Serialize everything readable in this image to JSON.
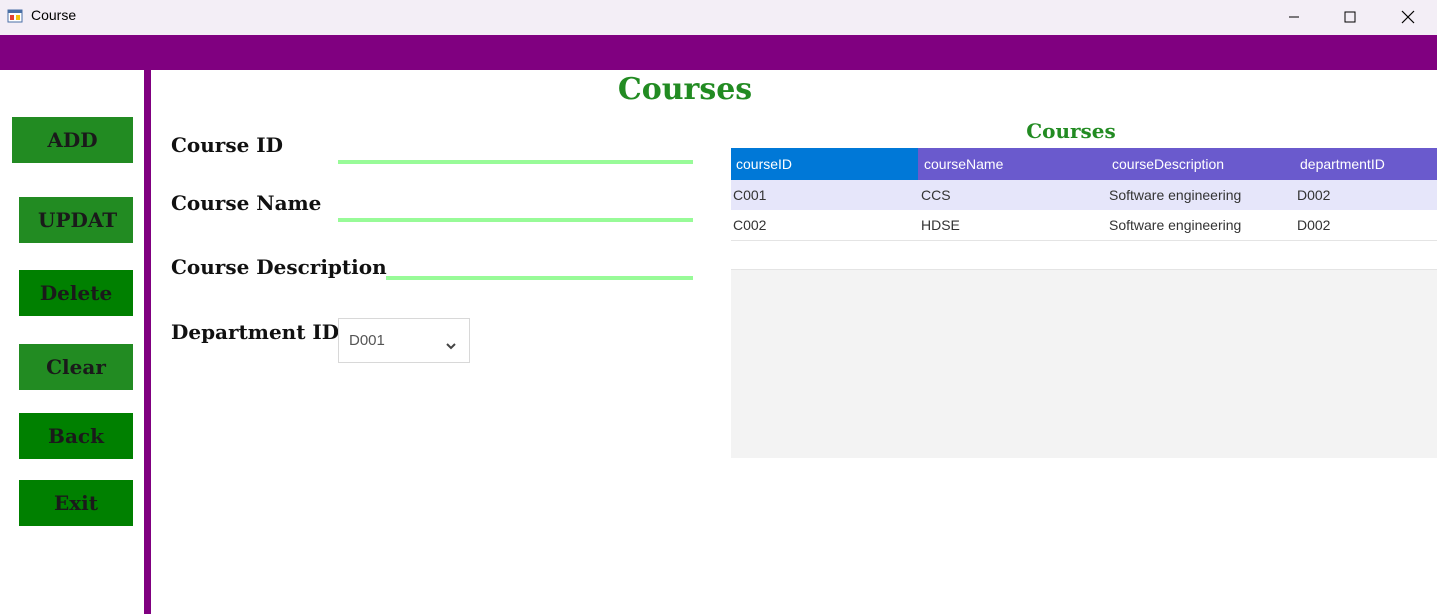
{
  "window": {
    "title": "Course",
    "icon": "windows-form-icon",
    "controls": [
      "minimize-icon",
      "maximize-icon",
      "close-icon"
    ]
  },
  "colors": {
    "header_band": "#800080",
    "title_green": "#228b22",
    "button_green": "#228b22",
    "button_green_dark": "#008000",
    "underline_green": "#98fb98",
    "grid_header": "#6a5acd",
    "grid_header_selected": "#0078d7",
    "grid_row_alt": "#e6e6fa"
  },
  "sidebar": {
    "buttons": [
      {
        "label": "ADD"
      },
      {
        "label": "UPDAT"
      },
      {
        "label": "Delete"
      },
      {
        "label": "Clear"
      },
      {
        "label": "Back"
      },
      {
        "label": "Exit"
      }
    ]
  },
  "main": {
    "title": "Courses"
  },
  "form": {
    "course_id_label": "Course ID",
    "course_id_value": "",
    "course_name_label": "Course Name",
    "course_name_value": "",
    "course_description_label": "Course Description",
    "course_description_value": "",
    "department_id_label": "Department ID",
    "department_id_value": "D001"
  },
  "grid": {
    "title": "Courses",
    "columns": [
      "courseID",
      "courseName",
      "courseDescription",
      "departmentID"
    ],
    "rows": [
      [
        "C001",
        "CCS",
        "Software engineering",
        "D002"
      ],
      [
        "C002",
        "HDSE",
        "Software engineering",
        "D002"
      ]
    ]
  }
}
